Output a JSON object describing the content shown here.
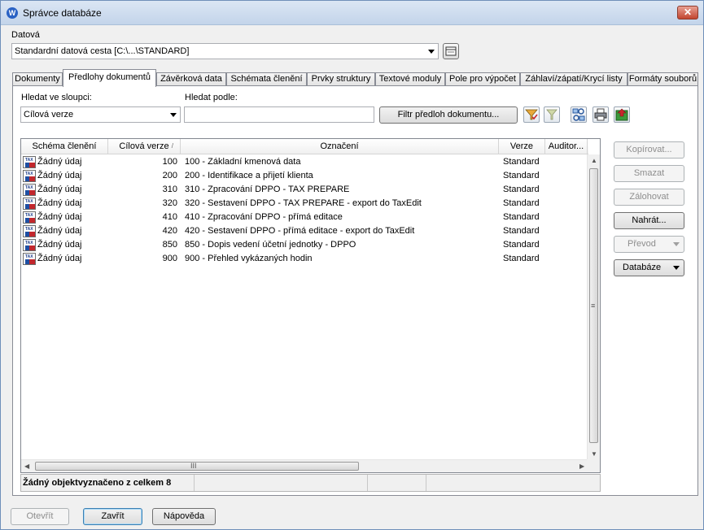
{
  "window": {
    "title": "Správce databáze",
    "app_icon_letter": "W",
    "close_glyph": "✕"
  },
  "datova": {
    "label": "Datová",
    "selected": "Standardní datová cesta [C:\\...\\STANDARD]"
  },
  "tabs": [
    {
      "label": "Dokumenty"
    },
    {
      "label": "Předlohy dokumentů",
      "active": true
    },
    {
      "label": "Závěrková data"
    },
    {
      "label": "Schémata členění"
    },
    {
      "label": "Prvky struktury"
    },
    {
      "label": "Textové moduly"
    },
    {
      "label": "Pole pro výpočet"
    },
    {
      "label": "Záhlaví/zápatí/Krycí listy"
    },
    {
      "label": "Formáty souborů"
    }
  ],
  "filter": {
    "column_label": "Hledat ve sloupci:",
    "column_selected": "Cílová verze",
    "search_label": "Hledat podle:",
    "search_value": "",
    "filter_button": "Filtr předloh dokumentu..."
  },
  "grid": {
    "columns": [
      "Schéma členění",
      "Cílová verze",
      "Označení",
      "Verze",
      "Auditor..."
    ],
    "sort_glyph": "/",
    "icon_text": "TAX",
    "rows": [
      {
        "schema": "Žádný údaj",
        "target": "100",
        "name": "100 - Základní kmenová data",
        "version": "Standard",
        "auditor": ""
      },
      {
        "schema": "Žádný údaj",
        "target": "200",
        "name": "200 - Identifikace a přijetí klienta",
        "version": "Standard",
        "auditor": ""
      },
      {
        "schema": "Žádný údaj",
        "target": "310",
        "name": "310 - Zpracování DPPO - TAX PREPARE",
        "version": "Standard",
        "auditor": ""
      },
      {
        "schema": "Žádný údaj",
        "target": "320",
        "name": "320 - Sestavení DPPO - TAX PREPARE - export do TaxEdit",
        "version": "Standard",
        "auditor": ""
      },
      {
        "schema": "Žádný údaj",
        "target": "410",
        "name": "410 - Zpracování DPPO - přímá editace",
        "version": "Standard",
        "auditor": ""
      },
      {
        "schema": "Žádný údaj",
        "target": "420",
        "name": "420 - Sestavení DPPO - přímá editace - export do TaxEdit",
        "version": "Standard",
        "auditor": ""
      },
      {
        "schema": "Žádný údaj",
        "target": "850",
        "name": "850 - Dopis vedení účetní jednotky - DPPO",
        "version": "Standard",
        "auditor": ""
      },
      {
        "schema": "Žádný údaj",
        "target": "900",
        "name": "900 - Přehled vykázaných hodin",
        "version": "Standard",
        "auditor": ""
      }
    ]
  },
  "status": {
    "text": "Žádný objektvyznačeno z celkem 8"
  },
  "side_buttons": {
    "copy": "Kopírovat...",
    "delete": "Smazat",
    "backup": "Zálohovat",
    "upload": "Nahrát...",
    "transfer": "Převod",
    "database": "Databáze"
  },
  "bottom_buttons": {
    "open": "Otevřít",
    "close": "Zavřít",
    "help": "Nápověda"
  },
  "scroll_glyphs": {
    "up": "▲",
    "down": "▼",
    "left": "◀",
    "right": "▶",
    "grip_v": "≡",
    "grip_h": "III"
  }
}
